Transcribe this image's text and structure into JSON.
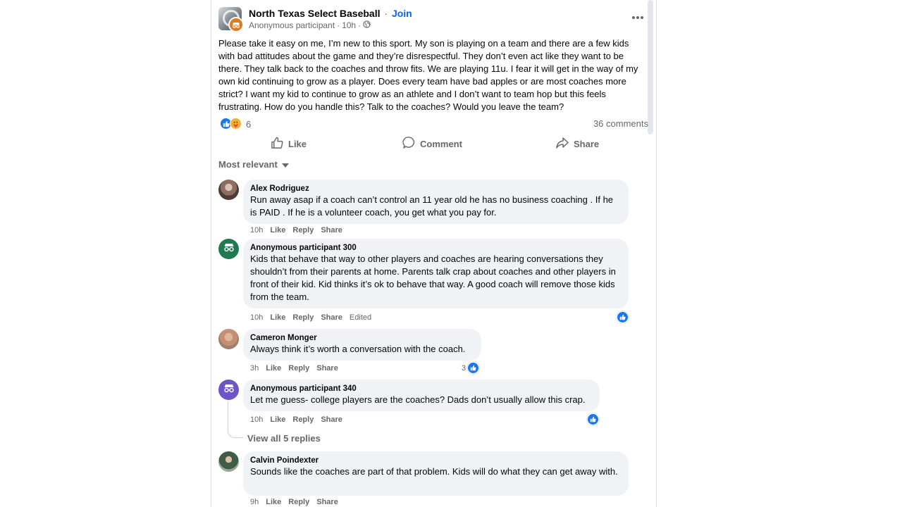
{
  "post": {
    "group_name": "North Texas Select Baseball",
    "separator": "·",
    "join_label": "Join",
    "author": "Anonymous participant",
    "time": "10h",
    "privacy_icon": "globe-icon",
    "body": "Please take it easy on me, I’m new to this sport. My son is playing on a team and there are a few kids with bad attitudes about the game and they’re disrespectful. They don’t even act like they want to be there. They talk back to the coaches and throw fits. We are playing 11u. I fear it will get in the way of my own kid continuing to grow as a player. Does every team have bad apples or are most coaches more strict? I want my kid to continue to grow as an athlete and I don’t want to team hop but this feels frustrating. How do you handle this? Talk to the coaches? Would you leave the team?",
    "reaction_count": "6",
    "comment_count": "36 comments"
  },
  "actions": {
    "like": "Like",
    "comment": "Comment",
    "share": "Share"
  },
  "sort": {
    "label": "Most relevant"
  },
  "comments": [
    {
      "author": "Alex Rodriguez",
      "text": "Run away asap if a coach can’t control an 11 year old he has no business coaching . If he is PAID . If he is a volunteer coach, you get what you pay for.",
      "time": "10h",
      "like": "Like",
      "reply": "Reply",
      "share": "Share"
    },
    {
      "author": "Anonymous participant 300",
      "text": "Kids that behave that way to other players and coaches are hearing conversations they shouldn’t from their parents at home. Parents talk crap about coaches and other players in front of their kid. Kid thinks it’s ok to behave that way. A good coach will remove those kids from the team.",
      "time": "10h",
      "like": "Like",
      "reply": "Reply",
      "share": "Share",
      "edited": "Edited"
    },
    {
      "author": "Cameron Monger",
      "text": "Always think it’s worth a conversation with the coach.",
      "time": "3h",
      "like": "Like",
      "reply": "Reply",
      "share": "Share",
      "reaction_count": "3"
    },
    {
      "author": "Anonymous participant 340",
      "text": "Let me guess- college players are the coaches? Dads don’t usually allow this crap.",
      "time": "10h",
      "like": "Like",
      "reply": "Reply",
      "share": "Share",
      "view_replies": "View all 5 replies"
    },
    {
      "author": "Calvin Poindexter",
      "text": "Sounds like the coaches are part of that problem. Kids will do what they can get away with.",
      "time": "9h",
      "like": "Like",
      "reply": "Reply",
      "share": "Share"
    }
  ],
  "colors": {
    "link_blue": "#0866ff",
    "like_blue": "#1877f2",
    "muted_text": "#65676b",
    "bubble_bg": "#f0f2f5"
  }
}
